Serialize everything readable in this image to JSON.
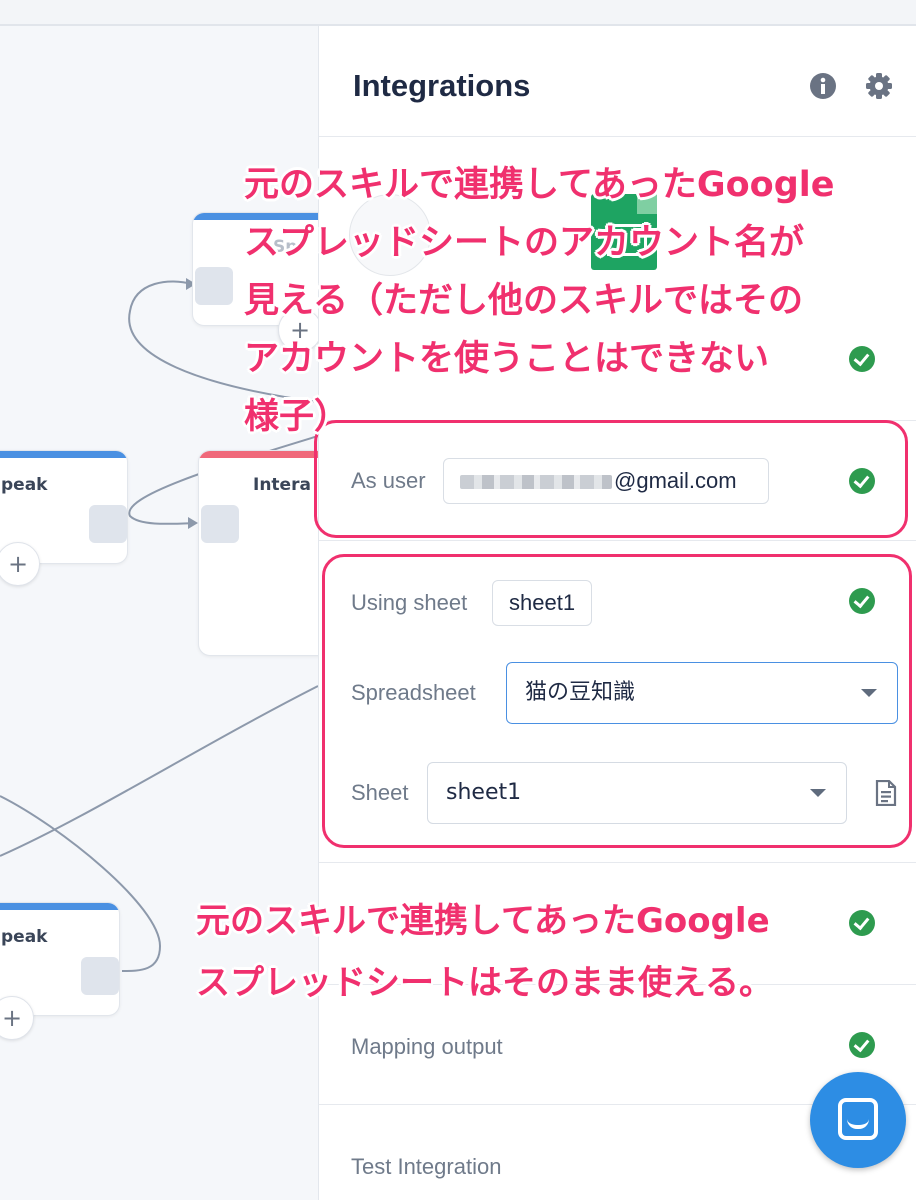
{
  "canvas": {
    "nodes": [
      {
        "title": "Sp",
        "accent": "#4a90e2"
      },
      {
        "title": "peak",
        "accent": "#4a90e2"
      },
      {
        "title": "Intera",
        "accent": "#f0687a"
      },
      {
        "title": "peak",
        "accent": "#4a90e2"
      }
    ],
    "plus_label": "+"
  },
  "panel": {
    "title": "Integrations",
    "info_icon": "info-icon",
    "settings_icon": "gear-icon",
    "as_user": {
      "label": "As user",
      "value_suffix": "@gmail.com"
    },
    "using_sheet": {
      "label": "Using sheet",
      "value": "sheet1"
    },
    "spreadsheet": {
      "label": "Spreadsheet",
      "value": "猫の豆知識"
    },
    "sheet": {
      "label": "Sheet",
      "value": "sheet1"
    },
    "mapping_output": {
      "label": "Mapping output"
    },
    "test_integration": {
      "label": "Test Integration"
    }
  },
  "annotations": {
    "top": [
      "元のスキルで連携してあったGoogle",
      "スプレッドシートのアカウント名が",
      "見える（ただし他のスキルではその",
      "アカウントを使うことはできない",
      "様子）"
    ],
    "bottom": [
      "元のスキルで連携してあったGoogle",
      "スプレッドシートはそのまま使える。"
    ]
  },
  "colors": {
    "accent_pink": "#f0306e",
    "success_green": "#2e9b4f",
    "focus_blue": "#4a90e2",
    "chat_blue": "#2d8de4"
  }
}
